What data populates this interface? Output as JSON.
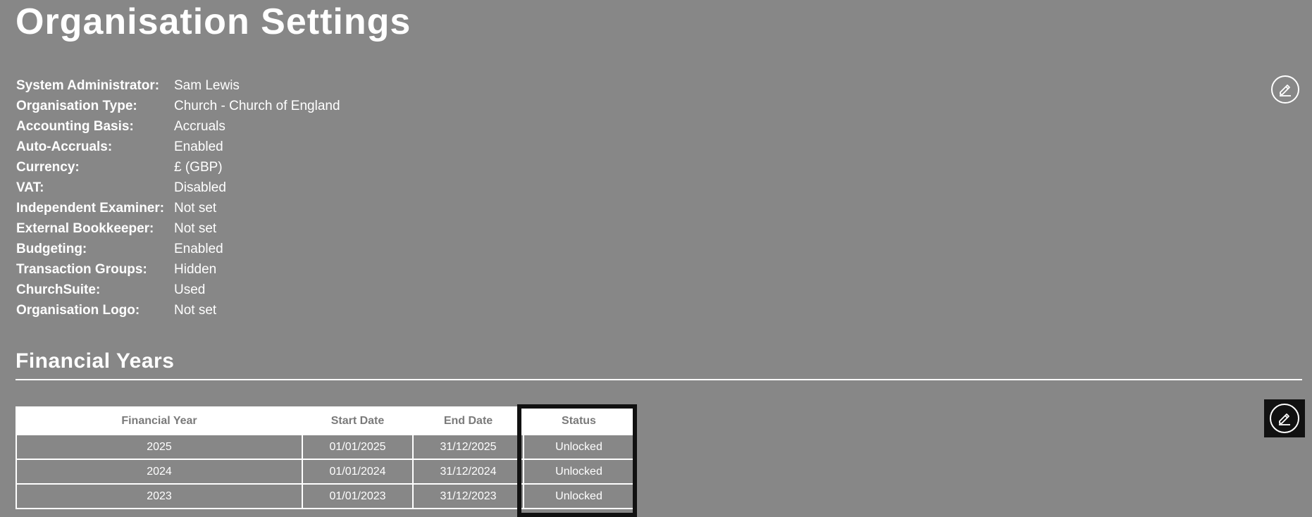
{
  "page": {
    "title": "Organisation Settings"
  },
  "settings": [
    {
      "label": "System Administrator:",
      "value": "Sam Lewis"
    },
    {
      "label": "Organisation Type:",
      "value": "Church - Church of England"
    },
    {
      "label": "Accounting Basis:",
      "value": "Accruals"
    },
    {
      "label": "Auto-Accruals:",
      "value": "Enabled"
    },
    {
      "label": "Currency:",
      "value": "£ (GBP)"
    },
    {
      "label": "VAT:",
      "value": "Disabled"
    },
    {
      "label": "Independent Examiner:",
      "value": "Not set"
    },
    {
      "label": "External Bookkeeper:",
      "value": "Not set"
    },
    {
      "label": "Budgeting:",
      "value": "Enabled"
    },
    {
      "label": "Transaction Groups:",
      "value": "Hidden"
    },
    {
      "label": "ChurchSuite:",
      "value": "Used"
    },
    {
      "label": "Organisation Logo:",
      "value": "Not set"
    }
  ],
  "financial_years": {
    "title": "Financial Years",
    "columns": [
      "Financial Year",
      "Start Date",
      "End Date",
      "Status"
    ],
    "rows": [
      {
        "year": "2025",
        "start": "01/01/2025",
        "end": "31/12/2025",
        "status": "Unlocked"
      },
      {
        "year": "2024",
        "start": "01/01/2024",
        "end": "31/12/2024",
        "status": "Unlocked"
      },
      {
        "year": "2023",
        "start": "01/01/2023",
        "end": "31/12/2023",
        "status": "Unlocked"
      }
    ]
  },
  "icons": {
    "settings_edit": "edit-icon",
    "financial_years_edit": "edit-icon"
  },
  "colors": {
    "background": "#878787",
    "text": "#ffffff",
    "highlight": "#111111"
  }
}
